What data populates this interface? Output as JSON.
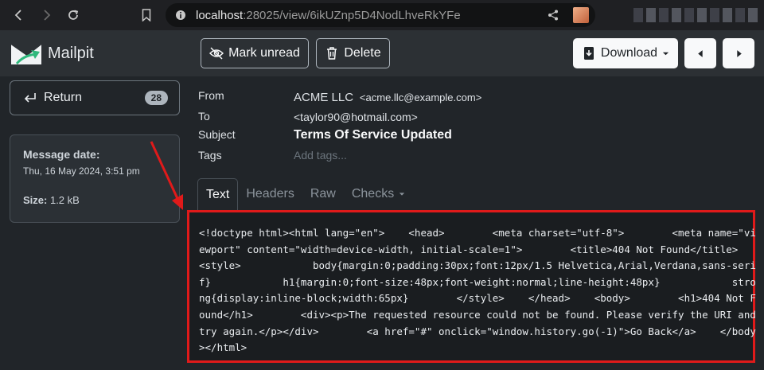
{
  "browser": {
    "url_host": "localhost",
    "url_rest": ":28025/view/6ikUZnp5D4NodLhveRkYFe"
  },
  "app": {
    "brand": "Mailpit"
  },
  "toolbar": {
    "mark_unread": "Mark unread",
    "delete": "Delete",
    "download": "Download"
  },
  "sidebar": {
    "return_label": "Return",
    "return_count": "28",
    "message_date_label": "Message date:",
    "message_date": "Thu, 16 May 2024, 3:51 pm",
    "size_label": "Size:",
    "size_value": "1.2 kB"
  },
  "message": {
    "from_label": "From",
    "from_name": "ACME LLC",
    "from_email": "<acme.llc@example.com>",
    "to_label": "To",
    "to_email": "<taylor90@hotmail.com>",
    "subject_label": "Subject",
    "subject": "Terms Of Service Updated",
    "tags_label": "Tags",
    "tags_placeholder": "Add tags..."
  },
  "tabs": [
    {
      "label": "Text"
    },
    {
      "label": "Headers"
    },
    {
      "label": "Raw"
    },
    {
      "label": "Checks"
    }
  ],
  "body_text": "<!doctype html><html lang=\"en\">    <head>        <meta charset=\"utf-8\">        <meta name=\"viewport\" content=\"width=device-width, initial-scale=1\">        <title>404 Not Found</title>        <style>            body{margin:0;padding:30px;font:12px/1.5 Helvetica,Arial,Verdana,sans-serif}            h1{margin:0;font-size:48px;font-weight:normal;line-height:48px}            strong{display:inline-block;width:65px}        </style>    </head>    <body>        <h1>404 Not Found</h1>        <div><p>The requested resource could not be found. Please verify the URI and try again.</p></div>        <a href=\"#\" onclick=\"window.history.go(-1)\">Go Back</a>    </body></html>",
  "colors": {
    "highlight_border": "#e01a1a",
    "logo_green": "#2fb87c"
  }
}
